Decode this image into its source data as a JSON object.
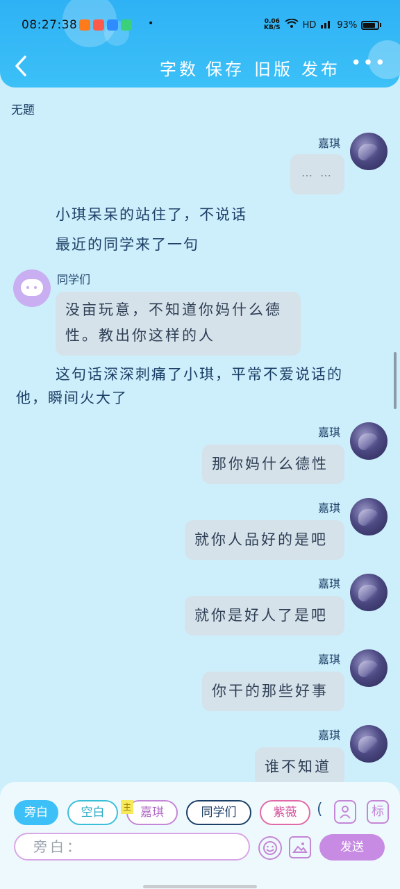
{
  "status": {
    "time": "08:27:38",
    "speed_top": "0.06",
    "speed_unit": "KB/S",
    "network": "HD",
    "battery": "93%"
  },
  "nav": {
    "back_icon": "chevron-left-icon",
    "word_count": "字数",
    "save": "保存",
    "old_version": "旧版",
    "publish": "发布",
    "more": "•••"
  },
  "doc_title": "无题",
  "messages": [
    {
      "type": "dialog",
      "side": "right",
      "sender": "嘉琪",
      "text": "… …"
    },
    {
      "type": "narration",
      "text": "小琪呆呆的站住了，不说话"
    },
    {
      "type": "narration",
      "text": "最近的同学来了一句"
    },
    {
      "type": "dialog",
      "side": "left",
      "sender": "同学们",
      "lines": [
        "没亩玩意，不知道你妈什么德",
        "性。教出你这样的人"
      ]
    },
    {
      "type": "narration",
      "lines": [
        "这句话深深刺痛了小琪，平常不爱说话的",
        "他，瞬间火大了"
      ]
    },
    {
      "type": "dialog",
      "side": "right",
      "sender": "嘉琪",
      "text": "那你妈什么德性"
    },
    {
      "type": "dialog",
      "side": "right",
      "sender": "嘉琪",
      "text": "就你人品好的是吧"
    },
    {
      "type": "dialog",
      "side": "right",
      "sender": "嘉琪",
      "text": "就你是好人了是吧"
    },
    {
      "type": "dialog",
      "side": "right",
      "sender": "嘉琪",
      "text": "你干的那些好事"
    },
    {
      "type": "dialog",
      "side": "right",
      "sender": "嘉琪",
      "text": "谁不知道"
    }
  ],
  "roles": {
    "narration": "旁白",
    "blank": "空白",
    "main_tag": "主",
    "jiaqi": "嘉琪",
    "classmates": "同学们",
    "ziwei": "紫薇",
    "overflow": "(",
    "tag_btn": "标"
  },
  "composer": {
    "placeholder": "旁白：",
    "send": "发送"
  },
  "colors": {
    "header": "#3cc0f7",
    "chat_bg": "#cdeefb",
    "bubble": "#d6e2ea",
    "accent_purple": "#c78be3",
    "narration_chip": "#3cc0f7"
  }
}
